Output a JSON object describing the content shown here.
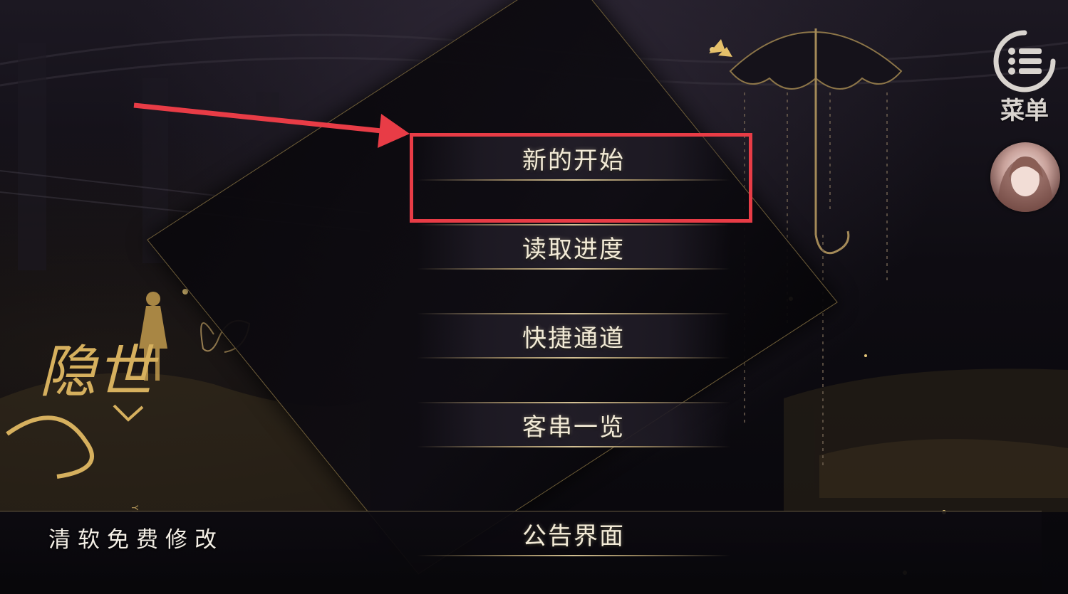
{
  "menu": {
    "items": [
      {
        "label": "新的开始"
      },
      {
        "label": "读取进度"
      },
      {
        "label": "快捷通道"
      },
      {
        "label": "客串一览"
      },
      {
        "label": "公告界面"
      }
    ]
  },
  "top_right": {
    "menu_label": "菜单",
    "menu_icon": "list-icon",
    "avatar_icon": "avatar"
  },
  "logo": {
    "title": "隐世",
    "subtitle": "YINS"
  },
  "watermark": "清软免费修改",
  "annotation": {
    "arrow_color": "#e83c46",
    "highlight_color": "#e83c46"
  },
  "colors": {
    "gold": "#d8b46a",
    "text": "#f2ead6",
    "background": "#0c0a10"
  }
}
